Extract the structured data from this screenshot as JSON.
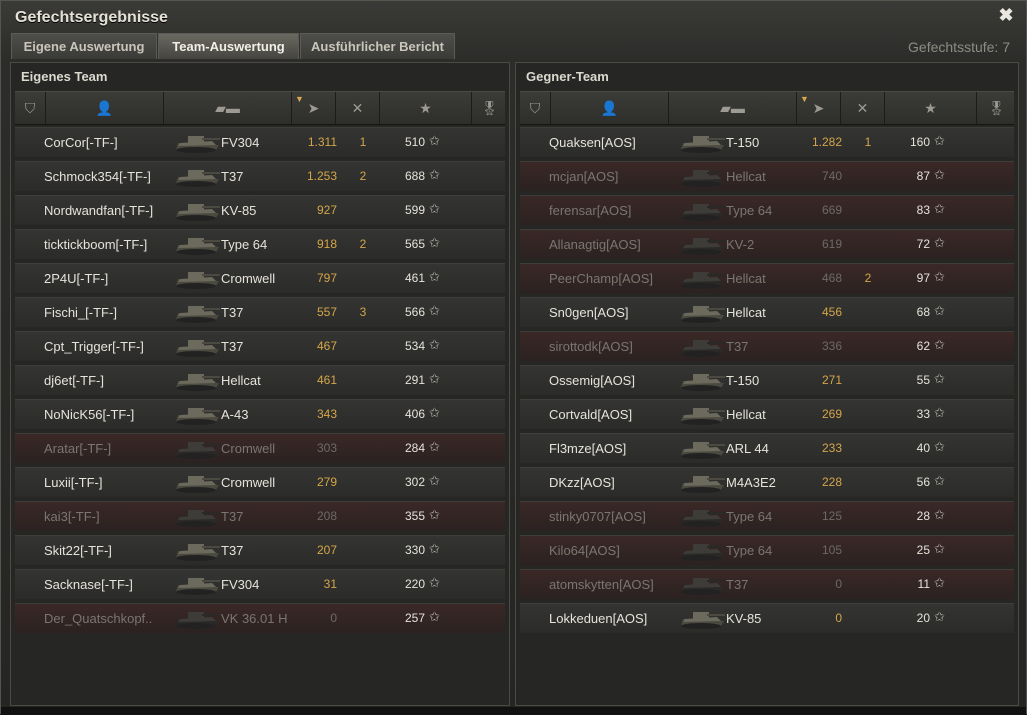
{
  "window": {
    "title": "Gefechtsergebnisse",
    "close_icon": "✖"
  },
  "tabs": [
    {
      "label": "Eigene Auswertung",
      "active": false
    },
    {
      "label": "Team-Auswertung",
      "active": true
    },
    {
      "label": "Ausführlicher Bericht",
      "active": false
    }
  ],
  "battle_level": "Gefechtsstufe: 7",
  "own_team": {
    "title": "Eigenes Team",
    "rows": [
      {
        "player": "CorCor[-TF-]",
        "tank": "FV304",
        "damage": "1.311",
        "kills": "1",
        "xp": "510",
        "dead": false
      },
      {
        "player": "Schmock354[-TF-]",
        "tank": "T37",
        "damage": "1.253",
        "kills": "2",
        "xp": "688",
        "dead": false
      },
      {
        "player": "Nordwandfan[-TF-]",
        "tank": "KV-85",
        "damage": "927",
        "kills": "",
        "xp": "599",
        "dead": false
      },
      {
        "player": "ticktickboom[-TF-]",
        "tank": "Type 64",
        "damage": "918",
        "kills": "2",
        "xp": "565",
        "dead": false
      },
      {
        "player": "2P4U[-TF-]",
        "tank": "Cromwell",
        "damage": "797",
        "kills": "",
        "xp": "461",
        "dead": false
      },
      {
        "player": "Fischi_[-TF-]",
        "tank": "T37",
        "damage": "557",
        "kills": "3",
        "xp": "566",
        "dead": false
      },
      {
        "player": "Cpt_Trigger[-TF-]",
        "tank": "T37",
        "damage": "467",
        "kills": "",
        "xp": "534",
        "dead": false
      },
      {
        "player": "dj6et[-TF-]",
        "tank": "Hellcat",
        "damage": "461",
        "kills": "",
        "xp": "291",
        "dead": false
      },
      {
        "player": "NoNicK56[-TF-]",
        "tank": "A-43",
        "damage": "343",
        "kills": "",
        "xp": "406",
        "dead": false
      },
      {
        "player": "Aratar[-TF-]",
        "tank": "Cromwell",
        "damage": "303",
        "kills": "",
        "xp": "284",
        "dead": true
      },
      {
        "player": "Luxii[-TF-]",
        "tank": "Cromwell",
        "damage": "279",
        "kills": "",
        "xp": "302",
        "dead": false
      },
      {
        "player": "kai3[-TF-]",
        "tank": "T37",
        "damage": "208",
        "kills": "",
        "xp": "355",
        "dead": true
      },
      {
        "player": "Skit22[-TF-]",
        "tank": "T37",
        "damage": "207",
        "kills": "",
        "xp": "330",
        "dead": false
      },
      {
        "player": "Sacknase[-TF-]",
        "tank": "FV304",
        "damage": "31",
        "kills": "",
        "xp": "220",
        "dead": false
      },
      {
        "player": "Der_Quatschkopf..",
        "tank": "VK 36.01 H",
        "damage": "0",
        "kills": "",
        "xp": "257",
        "dead": true
      }
    ]
  },
  "enemy_team": {
    "title": "Gegner-Team",
    "rows": [
      {
        "player": "Quaksen[AOS]",
        "tank": "T-150",
        "damage": "1.282",
        "kills": "1",
        "xp": "160",
        "dead": false
      },
      {
        "player": "mcjan[AOS]",
        "tank": "Hellcat",
        "damage": "740",
        "kills": "",
        "xp": "87",
        "dead": true
      },
      {
        "player": "ferensar[AOS]",
        "tank": "Type 64",
        "damage": "669",
        "kills": "",
        "xp": "83",
        "dead": true
      },
      {
        "player": "Allanagtig[AOS]",
        "tank": "KV-2",
        "damage": "619",
        "kills": "",
        "xp": "72",
        "dead": true
      },
      {
        "player": "PeerChamp[AOS]",
        "tank": "Hellcat",
        "damage": "468",
        "kills": "2",
        "xp": "97",
        "dead": true
      },
      {
        "player": "Sn0gen[AOS]",
        "tank": "Hellcat",
        "damage": "456",
        "kills": "",
        "xp": "68",
        "dead": false
      },
      {
        "player": "sirottodk[AOS]",
        "tank": "T37",
        "damage": "336",
        "kills": "",
        "xp": "62",
        "dead": true
      },
      {
        "player": "Ossemig[AOS]",
        "tank": "T-150",
        "damage": "271",
        "kills": "",
        "xp": "55",
        "dead": false
      },
      {
        "player": "Cortvald[AOS]",
        "tank": "Hellcat",
        "damage": "269",
        "kills": "",
        "xp": "33",
        "dead": false
      },
      {
        "player": "Fl3mze[AOS]",
        "tank": "ARL 44",
        "damage": "233",
        "kills": "",
        "xp": "40",
        "dead": false
      },
      {
        "player": "DKzz[AOS]",
        "tank": "M4A3E2",
        "damage": "228",
        "kills": "",
        "xp": "56",
        "dead": false
      },
      {
        "player": "stinky0707[AOS]",
        "tank": "Type 64",
        "damage": "125",
        "kills": "",
        "xp": "28",
        "dead": true
      },
      {
        "player": "Kilo64[AOS]",
        "tank": "Type 64",
        "damage": "105",
        "kills": "",
        "xp": "25",
        "dead": true
      },
      {
        "player": "atomskytten[AOS]",
        "tank": "T37",
        "damage": "0",
        "kills": "",
        "xp": "11",
        "dead": true
      },
      {
        "player": "Lokkeduen[AOS]",
        "tank": "KV-85",
        "damage": "0",
        "kills": "",
        "xp": "20",
        "dead": false
      }
    ]
  },
  "icons": {
    "rank": "rank-icon",
    "player": "player-icon",
    "tank": "tank-icon",
    "damage": "damage-icon",
    "kills": "kills-icon",
    "xp": "star-icon",
    "medal": "medal-icon"
  },
  "colors": {
    "accent": "#d5a64a",
    "dead_row": "#3a2826"
  }
}
